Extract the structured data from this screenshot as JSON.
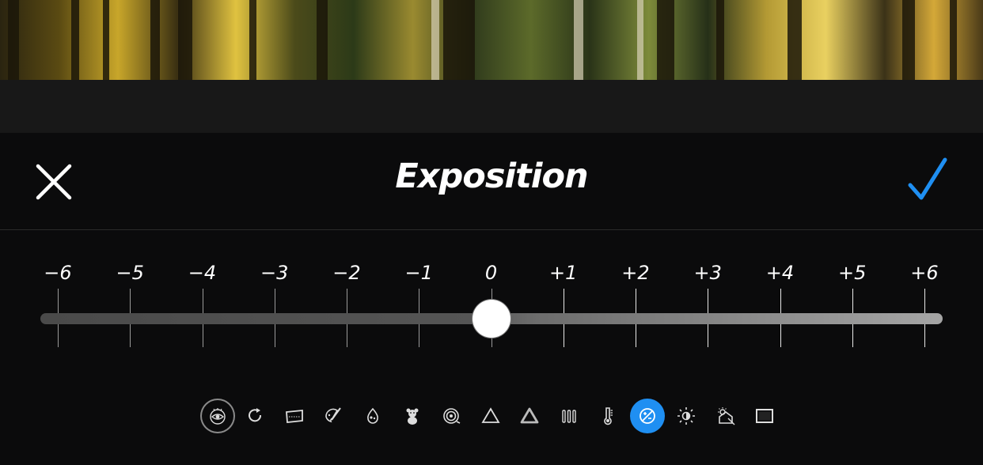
{
  "header": {
    "title": "Exposition",
    "close_icon": "close-x-icon",
    "confirm_icon": "checkmark-icon",
    "accent_color": "#1f8ff2"
  },
  "slider": {
    "labels": [
      "−6",
      "−5",
      "−4",
      "−3",
      "−2",
      "−1",
      "0",
      "+1",
      "+2",
      "+3",
      "+4",
      "+5",
      "+6"
    ],
    "min": -6,
    "max": 6,
    "value": 0
  },
  "toolbar": {
    "tools": [
      {
        "icon": "eye-preview-icon",
        "active": false
      },
      {
        "icon": "rotate-icon",
        "active": false
      },
      {
        "icon": "crop-perspective-icon",
        "active": false
      },
      {
        "icon": "palette-brush-icon",
        "active": false
      },
      {
        "icon": "droplets-icon",
        "active": false
      },
      {
        "icon": "teddy-bear-icon",
        "active": false
      },
      {
        "icon": "spiral-icon",
        "active": false
      },
      {
        "icon": "triangle-icon",
        "active": false
      },
      {
        "icon": "triangle-bold-icon",
        "active": false
      },
      {
        "icon": "hsl-bars-icon",
        "active": false
      },
      {
        "icon": "thermometer-icon",
        "active": false
      },
      {
        "icon": "exposure-icon",
        "active": true
      },
      {
        "icon": "brightness-icon",
        "active": false
      },
      {
        "icon": "shadows-highlights-icon",
        "active": false
      },
      {
        "icon": "vignette-icon",
        "active": false
      }
    ]
  }
}
